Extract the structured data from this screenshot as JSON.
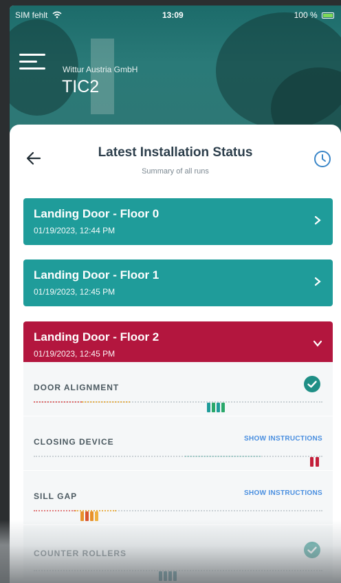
{
  "status_bar": {
    "carrier": "SIM fehlt",
    "time": "13:09",
    "battery": "100 %"
  },
  "header": {
    "company": "Wittur Austria GmbH",
    "device": "TIC2"
  },
  "screen": {
    "title": "Latest Installation Status",
    "subtitle": "Summary of all runs"
  },
  "doors": [
    {
      "name": "Landing Door - Floor 0",
      "date": "01/19/2023, 12:44 PM",
      "color": "#1f9c9a",
      "expanded": false
    },
    {
      "name": "Landing Door - Floor 1",
      "date": "01/19/2023, 12:45 PM",
      "color": "#1f9c9a",
      "expanded": false
    },
    {
      "name": "Landing Door - Floor 2",
      "date": "01/19/2023, 12:45 PM",
      "color": "#b3163e",
      "expanded": true
    }
  ],
  "checks": [
    {
      "name": "DOOR ALIGNMENT",
      "status": "ok",
      "icon": "check-circle-icon"
    },
    {
      "name": "CLOSING DEVICE",
      "link": "SHOW INSTRUCTIONS",
      "status": "fail"
    },
    {
      "name": "SILL GAP",
      "link": "SHOW INSTRUCTIONS",
      "status": "warning"
    },
    {
      "name": "COUNTER ROLLERS",
      "status": "ok",
      "icon": "check-circle-icon"
    }
  ],
  "colors": {
    "teal": "#1f9c9a",
    "red": "#b3163e",
    "link": "#4a8fe0",
    "ok": "#1f8f86",
    "warning": "#e8912a"
  }
}
